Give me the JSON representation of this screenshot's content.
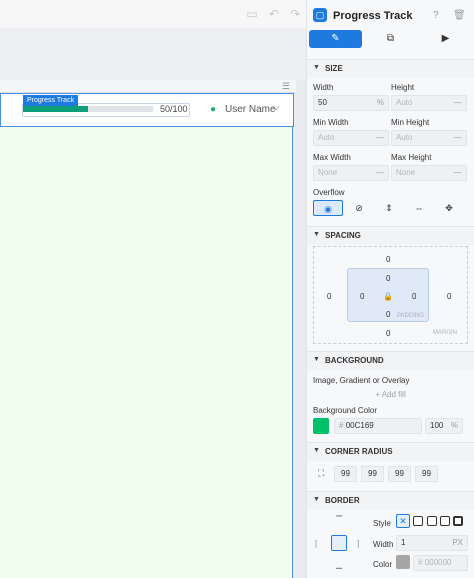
{
  "canvas": {
    "progress_tag": "Progress Track",
    "progress_value_text": "50/100",
    "progress_fraction": 0.5,
    "user_name": "User Name"
  },
  "panel": {
    "title": "Progress Track",
    "size": {
      "heading": "SIZE",
      "width_label": "Width",
      "width_value": "50",
      "width_unit": "%",
      "height_label": "Height",
      "height_placeholder": "Auto",
      "min_width_label": "Min Width",
      "min_width_placeholder": "Auto",
      "min_height_label": "Min Height",
      "min_height_placeholder": "Auto",
      "max_width_label": "Max Width",
      "max_width_placeholder": "None",
      "max_height_label": "Max Height",
      "max_height_placeholder": "None",
      "overflow_label": "Overflow"
    },
    "spacing": {
      "heading": "SPACING",
      "margin_top": "0",
      "margin_left": "0",
      "margin_right": "0",
      "margin_bottom": "0",
      "padding_top": "0",
      "padding_left": "0",
      "padding_right": "0",
      "padding_bottom": "0",
      "padding_tag": "PADDING",
      "margin_tag": "MARGIN"
    },
    "background": {
      "heading": "BACKGROUND",
      "subtitle": "Image, Gradient or Overlay",
      "add_fill": "Add fill",
      "color_label": "Background Color",
      "color_hex": "00C169",
      "color_swatch": "#00c169",
      "opacity": "100",
      "opacity_unit": "%"
    },
    "corner_radius": {
      "heading": "CORNER RADIUS",
      "values": [
        "99",
        "99",
        "99",
        "99"
      ]
    },
    "border": {
      "heading": "BORDER",
      "style_label": "Style",
      "width_label": "Width",
      "width_value": "1",
      "width_unit": "PX",
      "color_label": "Color",
      "color_placeholder": "000000"
    }
  },
  "colors": {
    "accent": "#1f7ae0",
    "progress": "#0c9f7a",
    "canvas_bg": "#f2fff0"
  }
}
